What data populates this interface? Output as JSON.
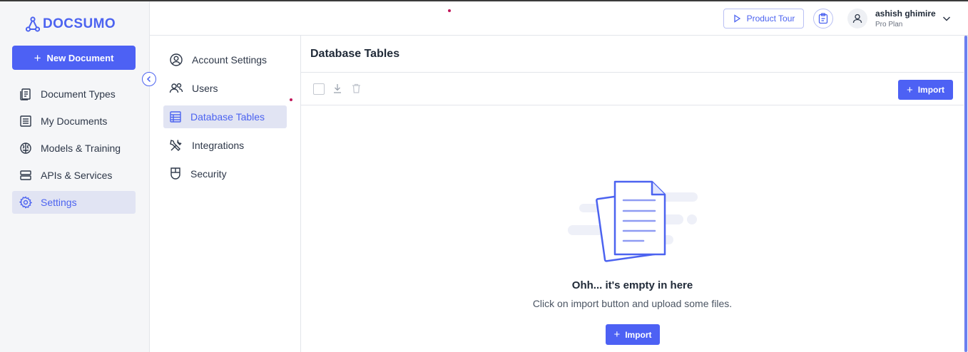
{
  "brand": {
    "name": "DOCSUMO",
    "accent": "#4d61f4"
  },
  "sidebar": {
    "new_document": "New Document",
    "items": [
      {
        "label": "Document Types",
        "icon": "document-types-icon"
      },
      {
        "label": "My Documents",
        "icon": "my-documents-icon"
      },
      {
        "label": "Models & Training",
        "icon": "brain-icon"
      },
      {
        "label": "APIs & Services",
        "icon": "server-icon"
      },
      {
        "label": "Settings",
        "icon": "gear-icon",
        "active": true
      }
    ]
  },
  "header": {
    "product_tour": "Product Tour",
    "user": {
      "name": "ashish ghimire",
      "plan": "Pro Plan"
    }
  },
  "settings_nav": {
    "items": [
      {
        "label": "Account Settings",
        "icon": "account-icon"
      },
      {
        "label": "Users",
        "icon": "users-icon"
      },
      {
        "label": "Database Tables",
        "icon": "table-icon",
        "active": true
      },
      {
        "label": "Integrations",
        "icon": "tools-icon"
      },
      {
        "label": "Security",
        "icon": "shield-icon"
      }
    ]
  },
  "main": {
    "title": "Database Tables",
    "import_label": "Import",
    "empty_title": "Ohh... it's empty in here",
    "empty_subtitle": "Click on import button and upload some files.",
    "empty_import_label": "Import"
  }
}
